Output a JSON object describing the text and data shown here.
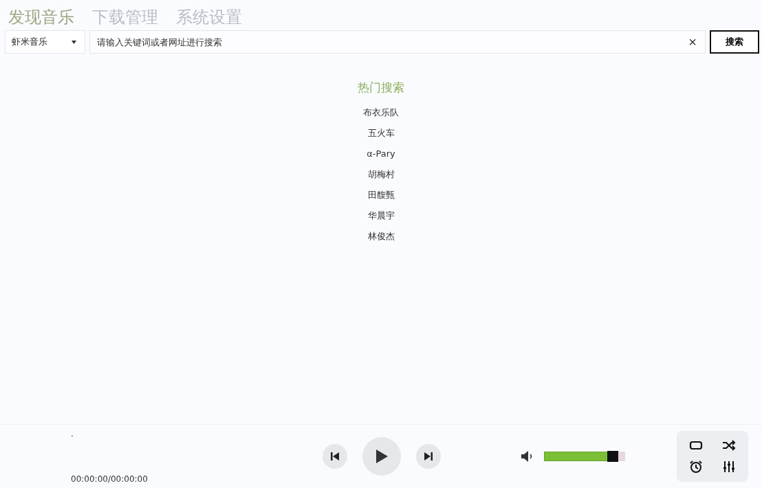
{
  "tabs": [
    {
      "label": "发现音乐",
      "selected": true
    },
    {
      "label": "下载管理",
      "selected": false
    },
    {
      "label": "系统设置",
      "selected": false
    }
  ],
  "search": {
    "source": "虾米音乐",
    "placeholder": "请输入关键词或者网址进行搜索",
    "clear": "×",
    "button": "搜索"
  },
  "hot": {
    "title": "热门搜索",
    "items": [
      "布衣乐队",
      "五火车",
      "α-Pary",
      "胡梅村",
      "田馥甄",
      "华晨宇",
      "林俊杰"
    ]
  },
  "player": {
    "song": ".",
    "time": "00:00:00/00:00:00",
    "volume": {
      "level": 0.85
    }
  }
}
